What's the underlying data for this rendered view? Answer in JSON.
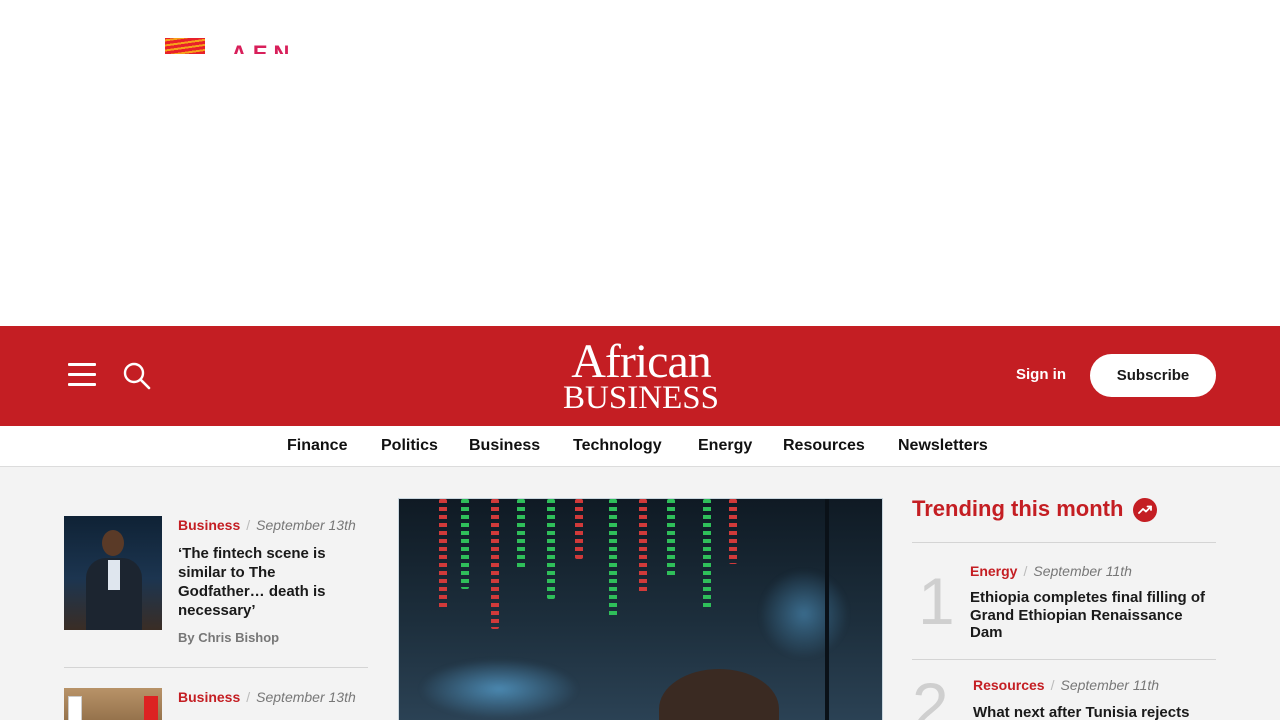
{
  "header": {
    "logo_line1": "African",
    "logo_line2": "BUSINESS",
    "signin_label": "Sign in",
    "subscribe_label": "Subscribe",
    "color_brand": "#c41e23"
  },
  "ad": {
    "brand_fragment": "AEN"
  },
  "nav": {
    "items": [
      "Finance",
      "Politics",
      "Business",
      "Technology",
      "Energy",
      "Resources",
      "Newsletters"
    ]
  },
  "left_column": {
    "articles": [
      {
        "category": "Business",
        "date": "September 13th",
        "headline": "‘The fintech scene is similar to The Godfather… death is necessary’",
        "byline": "By Chris Bishop"
      },
      {
        "category": "Business",
        "date": "September 13th",
        "headline": ""
      }
    ]
  },
  "trending": {
    "title": "Trending this month",
    "items": [
      {
        "rank": "1",
        "category": "Energy",
        "date": "September 11th",
        "headline": "Ethiopia completes final filling of Grand Ethiopian Renaissance Dam"
      },
      {
        "rank": "2",
        "category": "Resources",
        "date": "September 11th",
        "headline": "What next after Tunisia rejects"
      }
    ]
  },
  "icons": [
    "menu-icon",
    "search-icon",
    "trending-icon"
  ]
}
